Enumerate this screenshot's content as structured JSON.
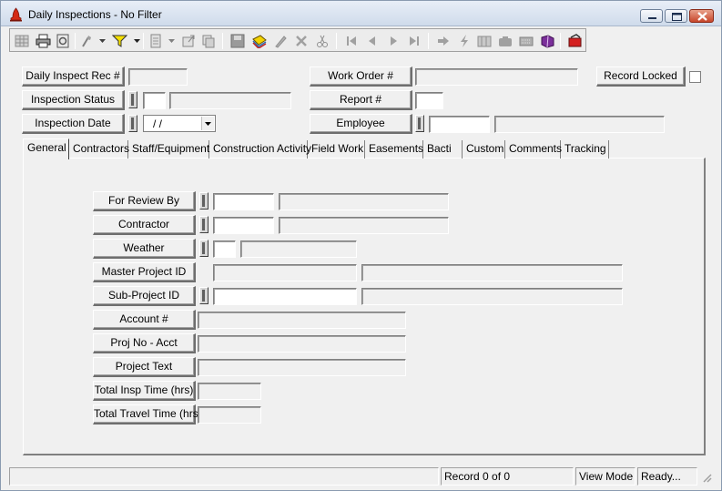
{
  "window": {
    "title": "Daily Inspections - No Filter"
  },
  "header_fields": {
    "daily_inspect_rec": {
      "label": "Daily Inspect Rec #",
      "value": ""
    },
    "inspection_status": {
      "label": "Inspection Status",
      "code": "",
      "description": ""
    },
    "inspection_date": {
      "label": "Inspection Date",
      "value": " /  /"
    },
    "work_order": {
      "label": "Work Order #",
      "value": ""
    },
    "report": {
      "label": "Report #",
      "value": ""
    },
    "employee": {
      "label": "Employee",
      "code": "",
      "name": ""
    },
    "record_locked": {
      "label": "Record Locked",
      "checked": false
    }
  },
  "tabs": [
    {
      "label": "General",
      "active": true
    },
    {
      "label": "Contractors",
      "active": false
    },
    {
      "label": "Staff/Equipment",
      "active": false
    },
    {
      "label": "Construction Activity",
      "active": false
    },
    {
      "label": "Field Work",
      "active": false
    },
    {
      "label": "Easements",
      "active": false
    },
    {
      "label": "Bacti",
      "active": false
    },
    {
      "label": "Custom",
      "active": false
    },
    {
      "label": "Comments",
      "active": false
    },
    {
      "label": "Tracking",
      "active": false
    }
  ],
  "general": {
    "for_review_by": {
      "label": "For Review By",
      "code": "",
      "name": ""
    },
    "contractor": {
      "label": "Contractor",
      "code": "",
      "name": ""
    },
    "weather": {
      "label": "Weather",
      "code": "",
      "description": ""
    },
    "master_project_id": {
      "label": "Master Project ID",
      "code": "",
      "name": ""
    },
    "sub_project_id": {
      "label": "Sub-Project ID",
      "code": "",
      "name": ""
    },
    "account": {
      "label": "Account #",
      "value": ""
    },
    "proj_no_acct": {
      "label": "Proj No - Acct",
      "value": ""
    },
    "project_text": {
      "label": "Project Text",
      "value": ""
    },
    "total_insp_time": {
      "label": "Total Insp Time (hrs)",
      "value": ""
    },
    "total_travel_time": {
      "label": "Total Travel Time (hrs)",
      "value": ""
    }
  },
  "status": {
    "record": "Record 0 of 0",
    "mode": "View Mode",
    "state": "Ready..."
  }
}
